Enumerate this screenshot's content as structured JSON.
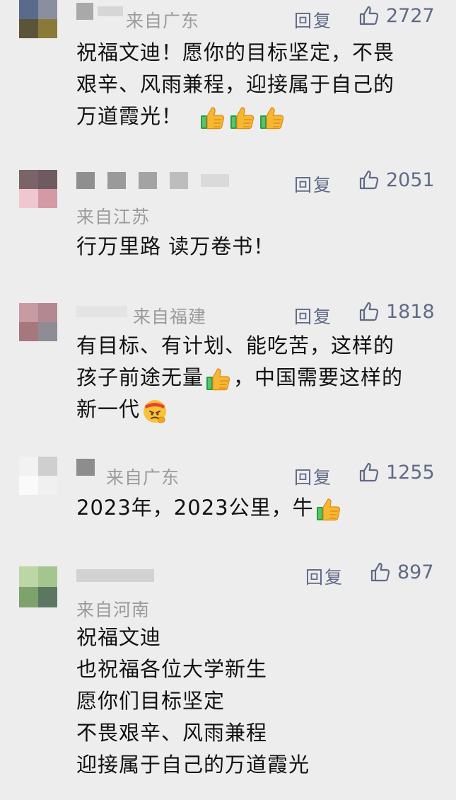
{
  "comments": [
    {
      "region": "来自广东",
      "reply": "回复",
      "likes": "2727",
      "text_lines": [
        "祝福文迪！愿你的目标坚定，不畏",
        "艰辛、风雨兼程，迎接属于自己的",
        "万道霞光！"
      ],
      "emojis": [
        "thumbs-up",
        "thumbs-up",
        "thumbs-up"
      ]
    },
    {
      "region": "来自江苏",
      "reply": "回复",
      "likes": "2051",
      "text_lines": [
        "行万里路 读万卷书！"
      ]
    },
    {
      "region": "来自福建",
      "reply": "回复",
      "likes": "1818",
      "text_lines": [
        "有目标、有计划、能吃苦，这样的",
        "孩子前途无量",
        "，中国需要这样的",
        "新一代"
      ],
      "emojis": [
        "thumbs-up",
        "determined-face"
      ]
    },
    {
      "region": "来自广东",
      "reply": "回复",
      "likes": "1255",
      "text_lines": [
        "2023年，2023公里，牛"
      ],
      "emojis": [
        "thumbs-up"
      ]
    },
    {
      "region": "来自河南",
      "reply": "回复",
      "likes": "897",
      "text_lines": [
        "祝福文迪",
        "也祝福各位大学新生",
        "愿你们目标坚定",
        "不畏艰辛、风雨兼程",
        "迎接属于自己的万道霞光"
      ]
    }
  ],
  "colors": {
    "background": "#ededed",
    "action_text": "#5f6a86",
    "region_text": "#9b9b9b",
    "body_text": "#111111"
  },
  "icons": {
    "like": "thumbs-up-outline-icon",
    "emoji_thumbs": "thumbs-up-emoji-icon",
    "emoji_face": "determined-face-emoji-icon"
  }
}
